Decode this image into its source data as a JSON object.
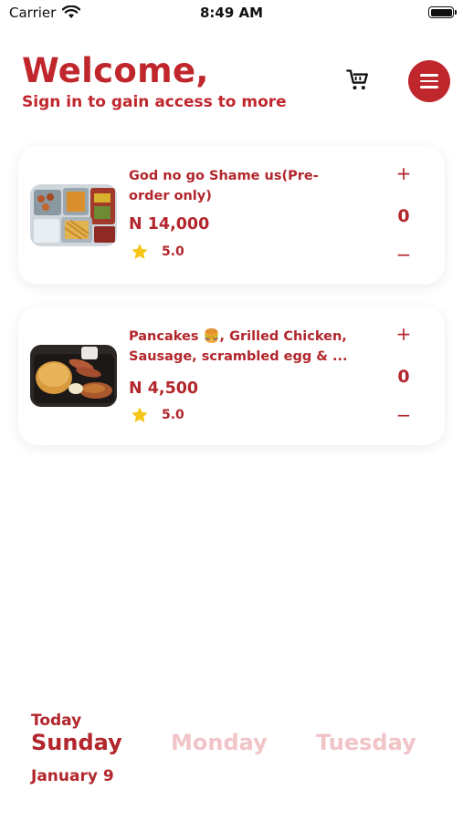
{
  "status_bar": {
    "carrier": "Carrier",
    "time": "8:49 AM",
    "wifi_icon": "wifi-icon",
    "battery_icon": "battery-icon"
  },
  "header": {
    "title": "Welcome,",
    "subtitle": "Sign in to gain access to more",
    "cart_icon": "cart-icon",
    "menu_icon": "hamburger-menu-icon"
  },
  "menu_items": [
    {
      "name": "God no go Shame us(Pre-order only)",
      "price": "N 14,000",
      "rating": "5.0",
      "quantity": "0",
      "plus": "+",
      "minus": "−",
      "image_icon": "food-tray-image"
    },
    {
      "name": "Pancakes 🍔, Grilled Chicken, Sausage, scrambled egg & ...",
      "price": "N 4,500",
      "rating": "5.0",
      "quantity": "0",
      "plus": "+",
      "minus": "−",
      "image_icon": "pancake-platter-image"
    }
  ],
  "day_selector": {
    "today_label": "Today",
    "days": [
      "Sunday",
      "Monday",
      "Tuesday"
    ],
    "selected_day": "Sunday",
    "date": "January 9"
  },
  "colors": {
    "accent": "#c0272d",
    "inactive_day": "#f1c4c7",
    "star": "#f5c518"
  }
}
